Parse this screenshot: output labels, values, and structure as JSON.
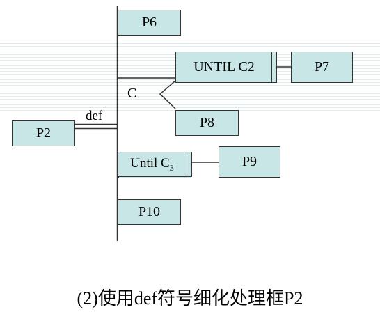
{
  "boxes": {
    "p6": "P6",
    "until_c2": "UNTIL C2",
    "p7": "P7",
    "p8": "P8",
    "p2": "P2",
    "until_c3": "Until C",
    "until_c3_sub": "3",
    "p9": "P9",
    "p10": "P10"
  },
  "labels": {
    "c": "C",
    "def": "def"
  },
  "caption": "(2)使用def符号细化处理框P2"
}
